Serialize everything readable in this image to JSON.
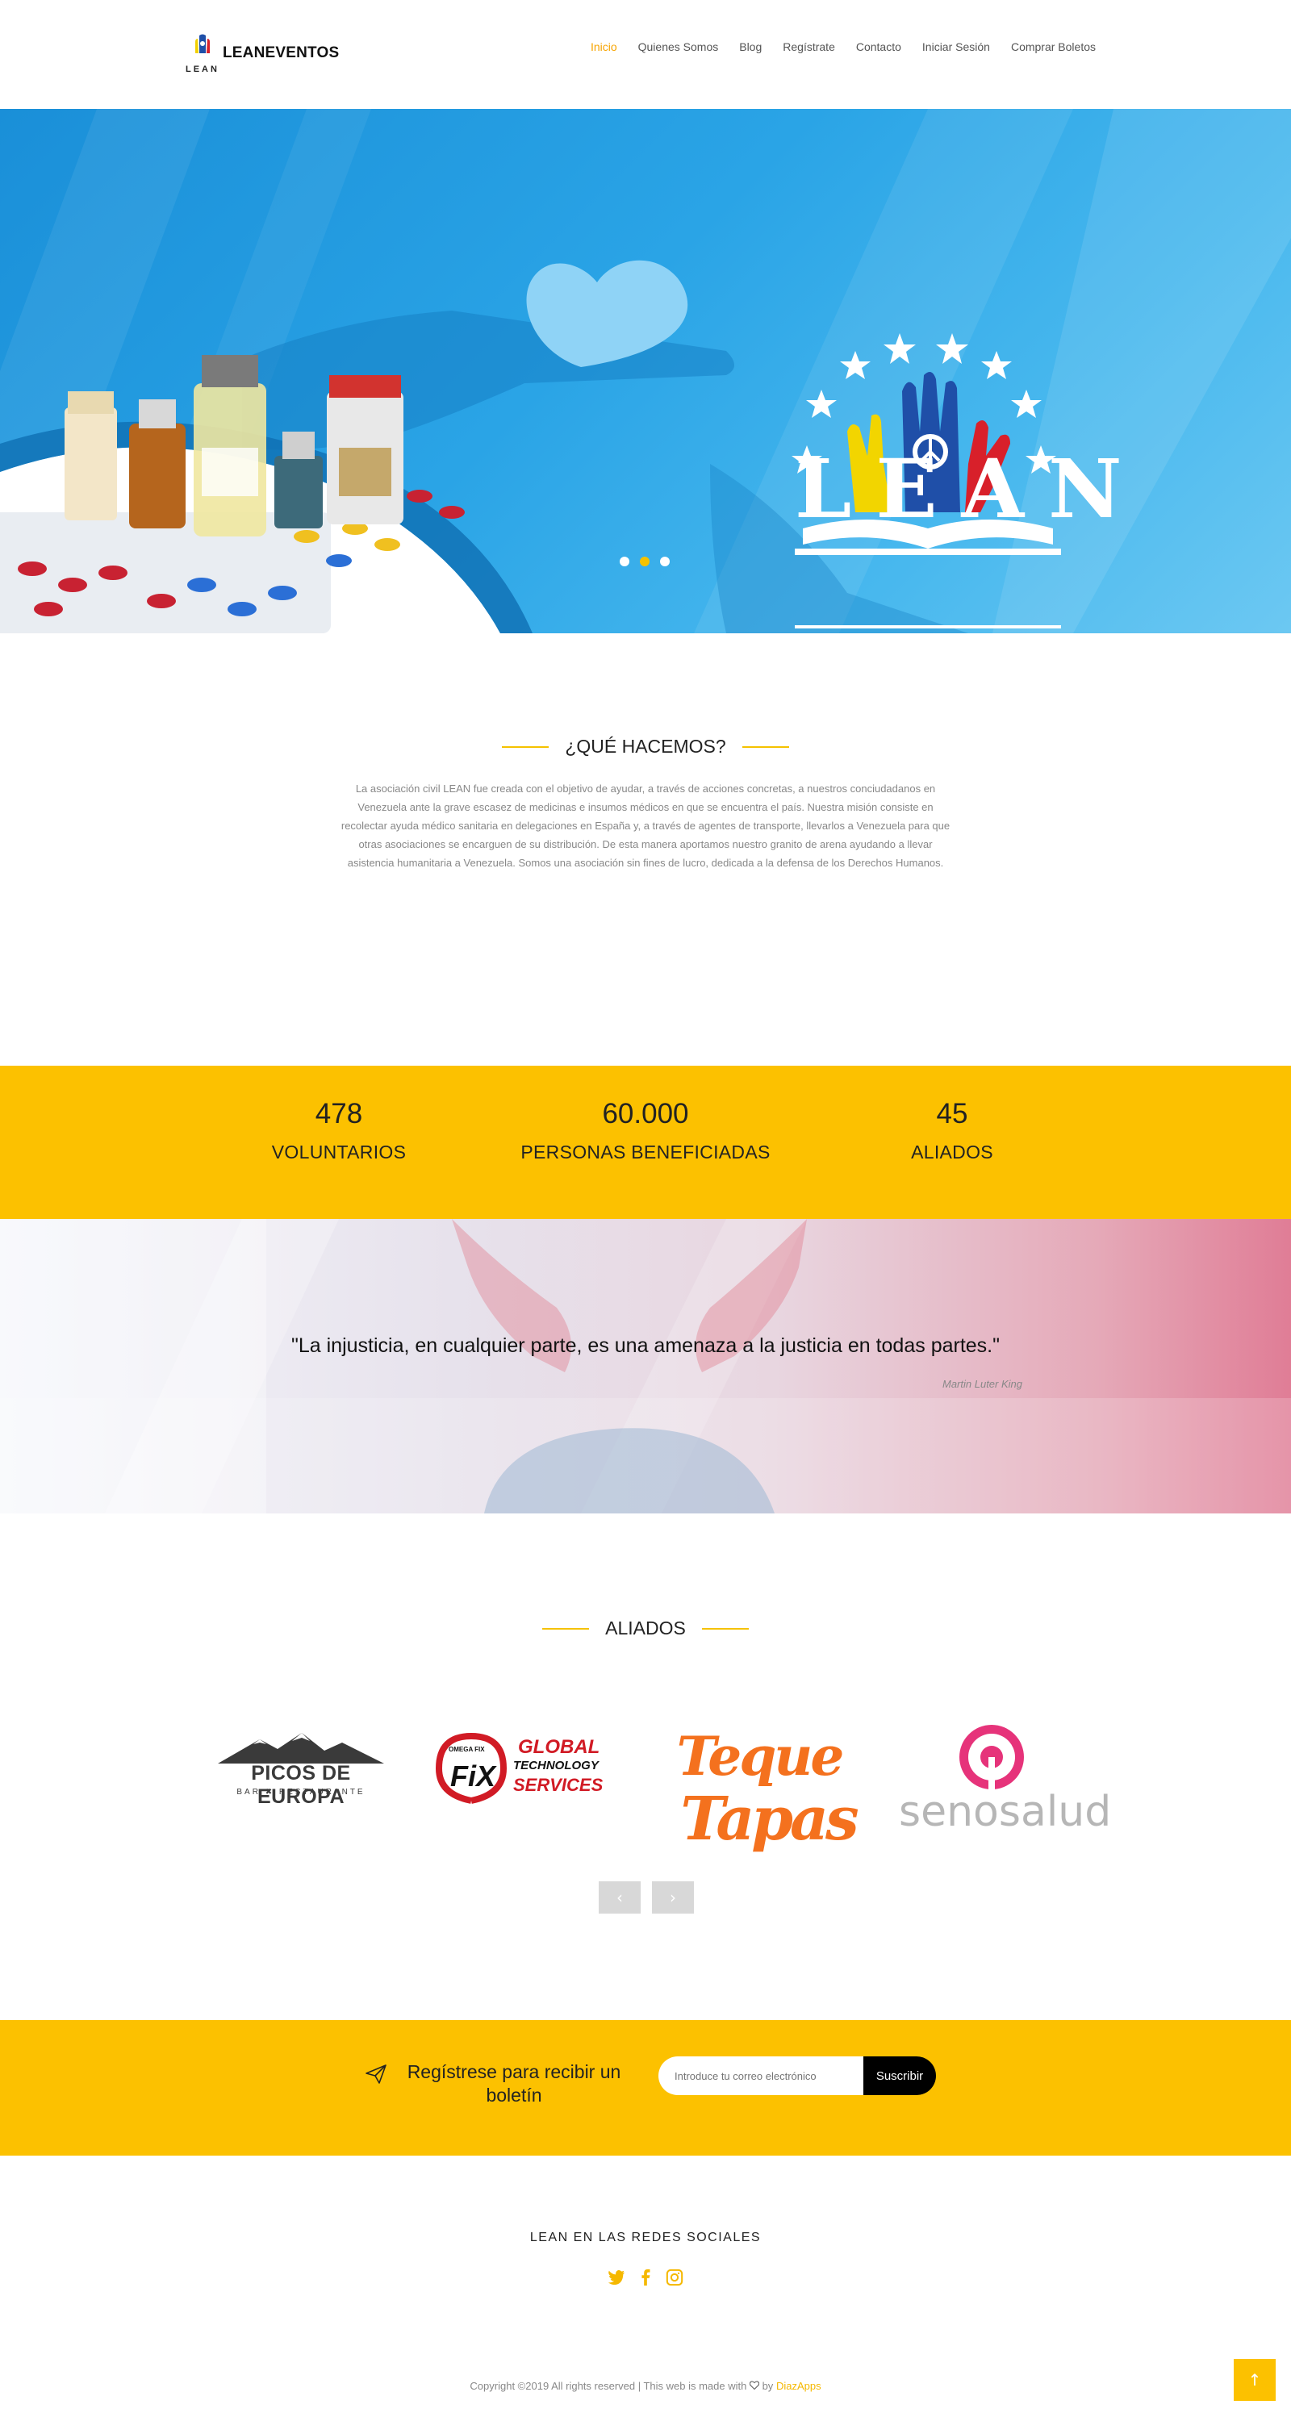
{
  "header": {
    "logo_text": "LEANEVENTOS",
    "logo_mini": "LEAN",
    "nav": [
      "Inicio",
      "Quienes Somos",
      "Blog",
      "Regístrate",
      "Contacto",
      "Iniciar Sesión",
      "Comprar Boletos"
    ],
    "active_nav": "Inicio"
  },
  "hero": {
    "logo_word": "LEAN",
    "slides": 3,
    "active_slide": 2
  },
  "about": {
    "title": "¿QUÉ HACEMOS?",
    "text": "La asociación civil LEAN fue creada con el objetivo de ayudar, a través de acciones concretas, a nuestros conciudadanos en Venezuela ante la grave escasez de medicinas e insumos médicos en que se encuentra el país. Nuestra misión consiste en recolectar ayuda médico sanitaria en delegaciones en España y, a través de agentes de transporte, llevarlos a Venezuela para que otras asociaciones se encarguen de su distribución. De esta manera aportamos nuestro granito de arena ayudando a llevar asistencia humanitaria a Venezuela. Somos una asociación sin fines de lucro, dedicada a la defensa de los Derechos Humanos."
  },
  "stats": [
    {
      "number": "478",
      "label": "VOLUNTARIOS"
    },
    {
      "number": "60.000",
      "label": "PERSONAS BENEFICIADAS"
    },
    {
      "number": "45",
      "label": "ALIADOS"
    }
  ],
  "quote": {
    "text": "\"La injusticia, en cualquier parte, es una amenaza a la justicia en todas partes.\"",
    "author": "Martin Luter King"
  },
  "partners": {
    "title": "ALIADOS",
    "logos": [
      {
        "name": "PICOS DE EUROPA",
        "sub": "BAR ✖ RESTAURANTE"
      },
      {
        "name": "OMEGA FIX",
        "sub1": "GLOBAL",
        "sub2": "TECHNOLOGY",
        "sub3": "SERVICES"
      },
      {
        "name": "Teque Tapas",
        "line1": "Teque",
        "line2": "Tapas"
      },
      {
        "name": "senosalud"
      }
    ],
    "prev": "‹",
    "next": "›"
  },
  "newsletter": {
    "text": "Regístrese para recibir un boletín",
    "placeholder": "Introduce tu correo electrónico",
    "button": "Suscribir"
  },
  "social": {
    "title": "LEAN EN LAS REDES SOCIALES",
    "icons": [
      "twitter-icon",
      "facebook-icon",
      "instagram-icon"
    ]
  },
  "footer": {
    "copyright": "Copyright ©2019 All rights reserved | This web is made with ",
    "by": " by ",
    "brand": "DiazApps"
  },
  "back_to_top": "↑",
  "colors": {
    "accent": "#fcc100",
    "nav_active": "#f7a400",
    "hero_blue": "#2aa4e6"
  }
}
